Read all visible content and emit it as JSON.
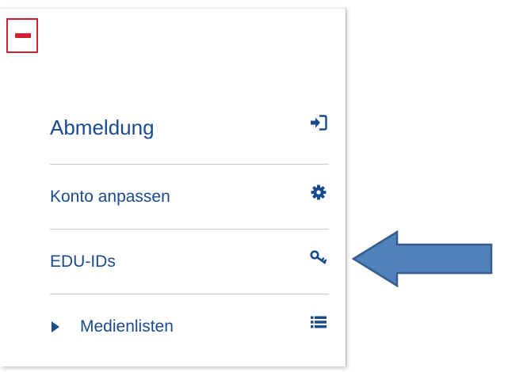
{
  "menu": {
    "items": [
      {
        "label": "Abmeldung",
        "icon": "sign-in-icon"
      },
      {
        "label": "Konto anpassen",
        "icon": "gear-icon"
      },
      {
        "label": "EDU-IDs",
        "icon": "key-icon"
      },
      {
        "label": "Medienlisten",
        "icon": "list-icon",
        "expandable": true
      }
    ]
  },
  "colors": {
    "link": "#1a4b8c",
    "highlight": "#d11f2f",
    "arrow_fill": "#4f81bd",
    "arrow_stroke": "#385d8a"
  }
}
